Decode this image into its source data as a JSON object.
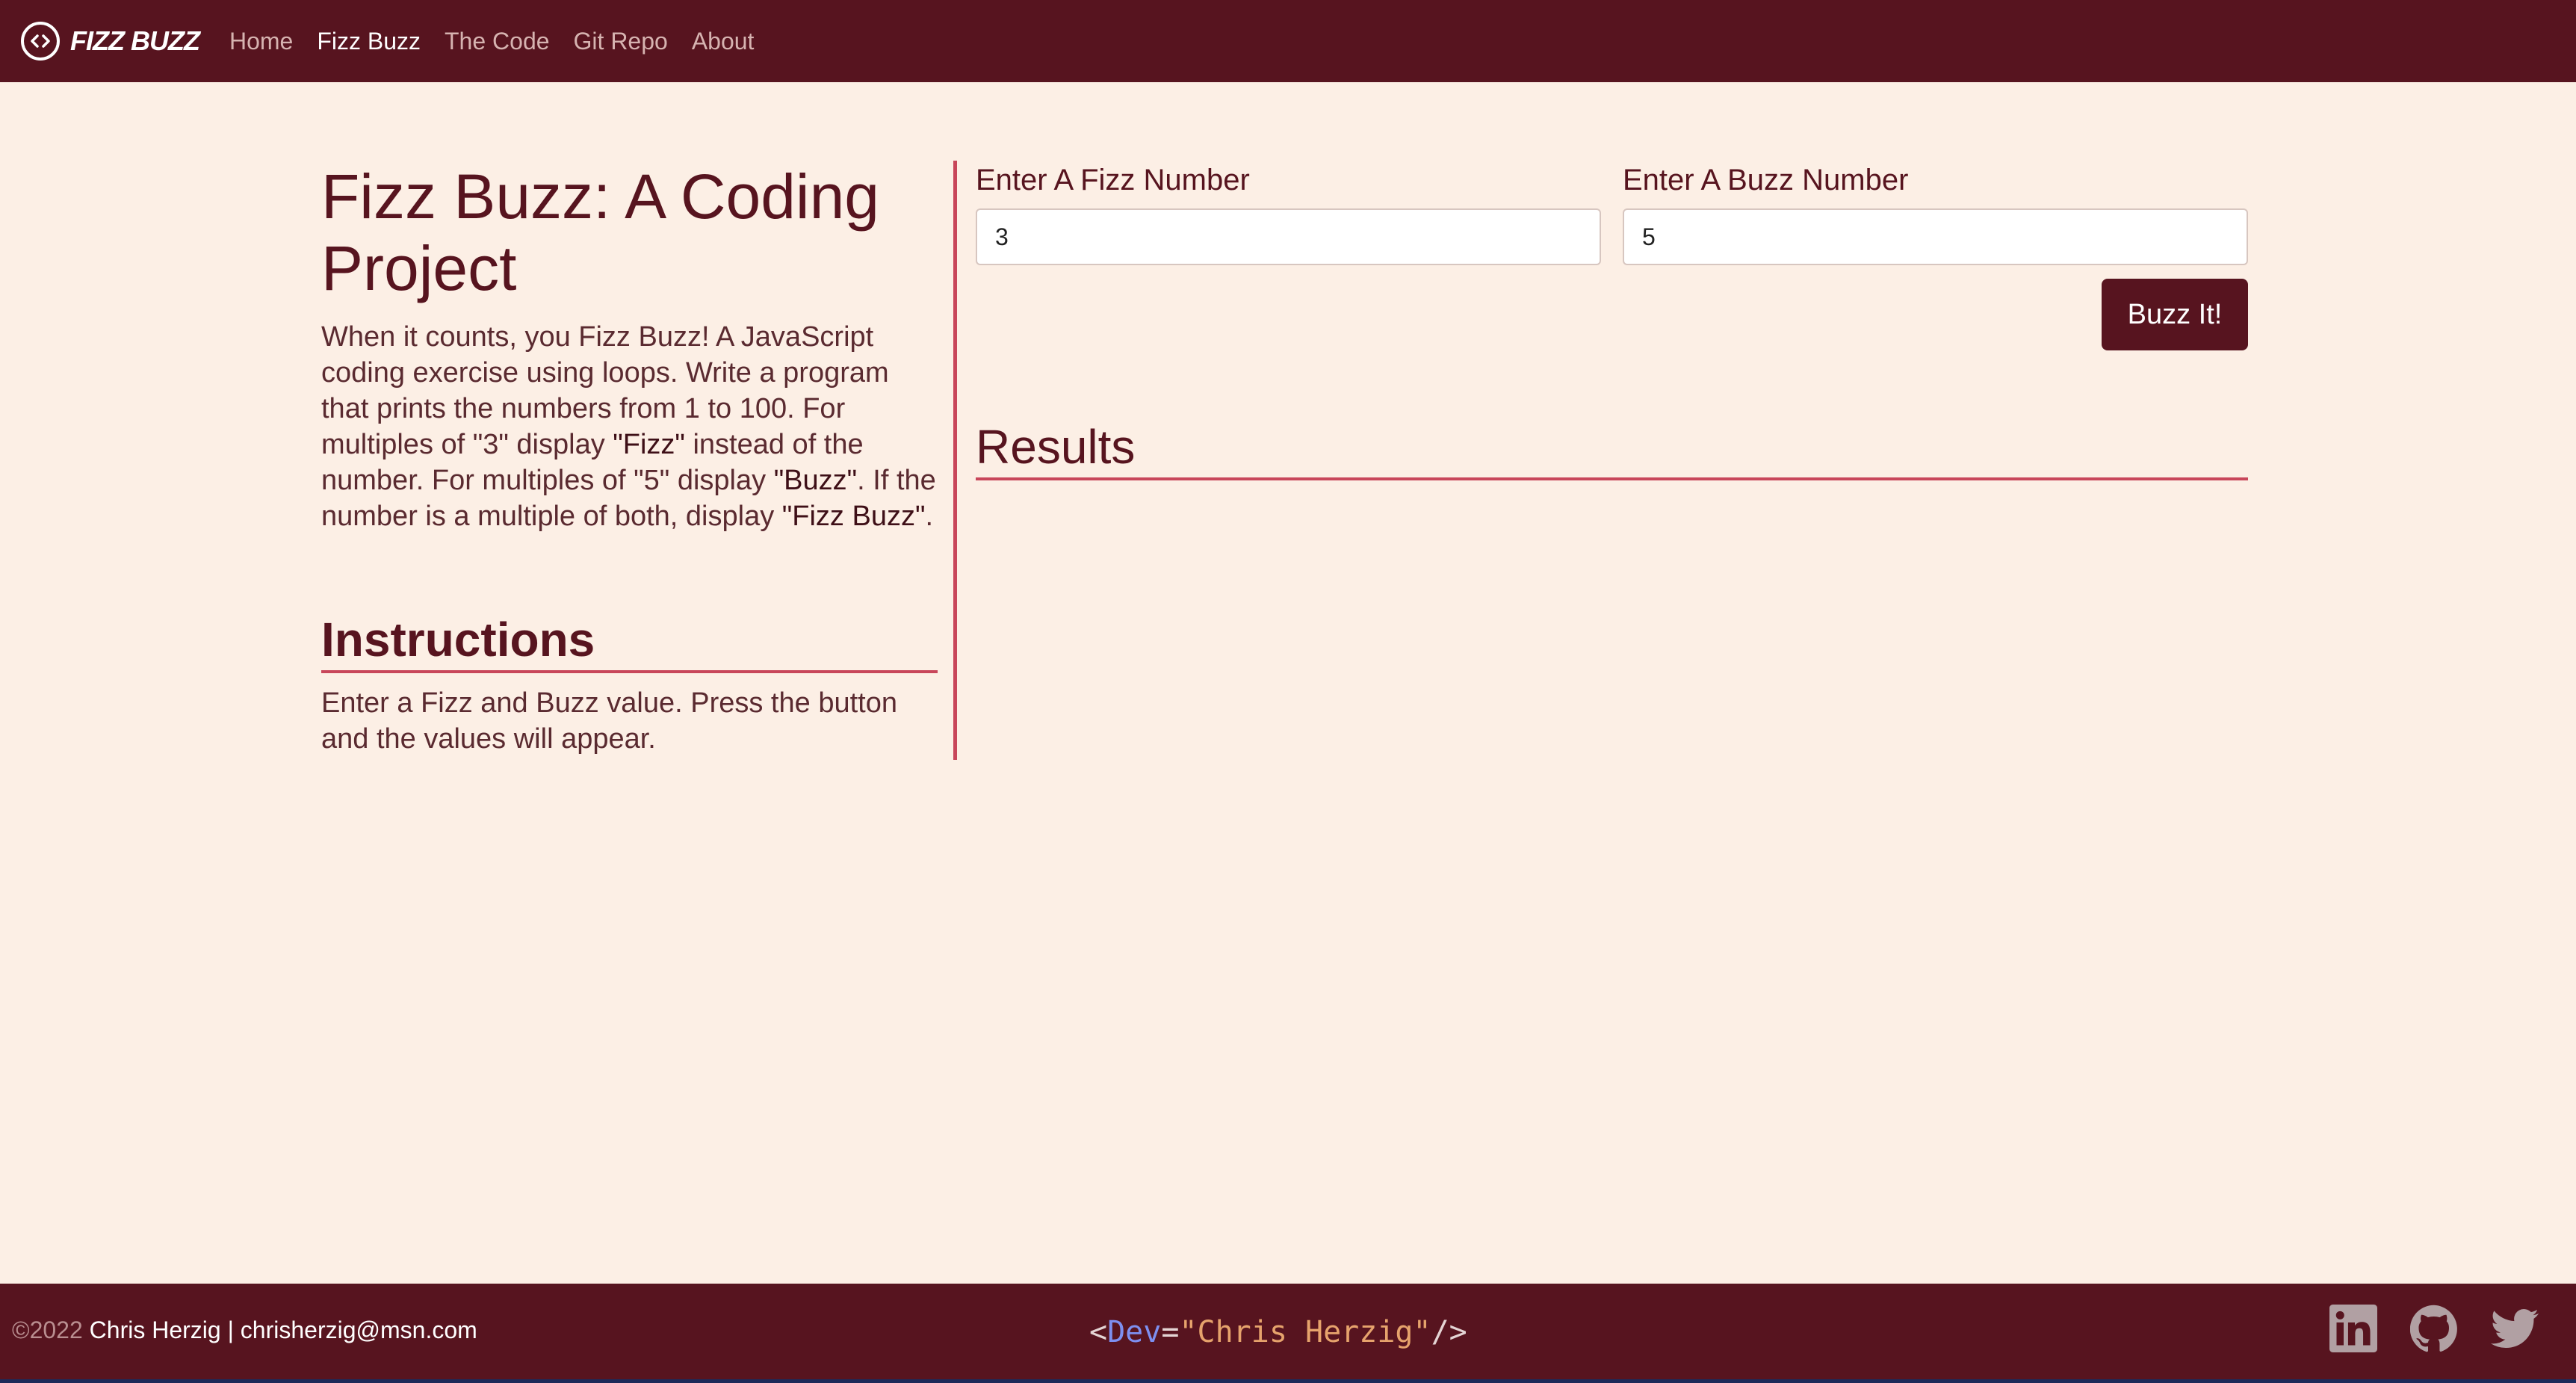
{
  "navbar": {
    "brand": "FIZZ BUZZ",
    "links": [
      "Home",
      "Fizz Buzz",
      "The Code",
      "Git Repo",
      "About"
    ],
    "active": "Fizz Buzz"
  },
  "main": {
    "title": "Fizz Buzz: A Coding Project",
    "intro": {
      "part1": "When it counts, you Fizz Buzz! A JavaScript coding exercise using loops. Write a program that prints the numbers from 1 to 100. For multiples of \"3\" display ",
      "fizz": "\"Fizz\"",
      "part2": " instead of the number. For multiples of \"5\" display ",
      "buzz": "\"Buzz\"",
      "part3": ". If the number is a multiple of both, display ",
      "fizzbuzz": "\"Fizz Buzz\"",
      "part4": "."
    },
    "instructions_heading": "Instructions",
    "instructions_text": "Enter a Fizz and Buzz value. Press the button and the values will appear."
  },
  "form": {
    "fizz_label": "Enter A Fizz Number",
    "fizz_value": "3",
    "buzz_label": "Enter A Buzz Number",
    "buzz_value": "5",
    "button_label": "Buzz It!"
  },
  "results": {
    "heading": "Results"
  },
  "footer": {
    "year": "©2022",
    "credit": " Chris Herzig | chrisherzig@msn.com",
    "code_open": "<",
    "code_tag": "Dev",
    "code_eq": "=",
    "code_str": "\"Chris Herzig\"",
    "code_close": "/>",
    "icons": [
      "linkedin-icon",
      "github-icon",
      "twitter-icon"
    ]
  },
  "colors": {
    "primary": "#57141f",
    "background": "#fcefe5",
    "accent_line": "#c8465a"
  }
}
